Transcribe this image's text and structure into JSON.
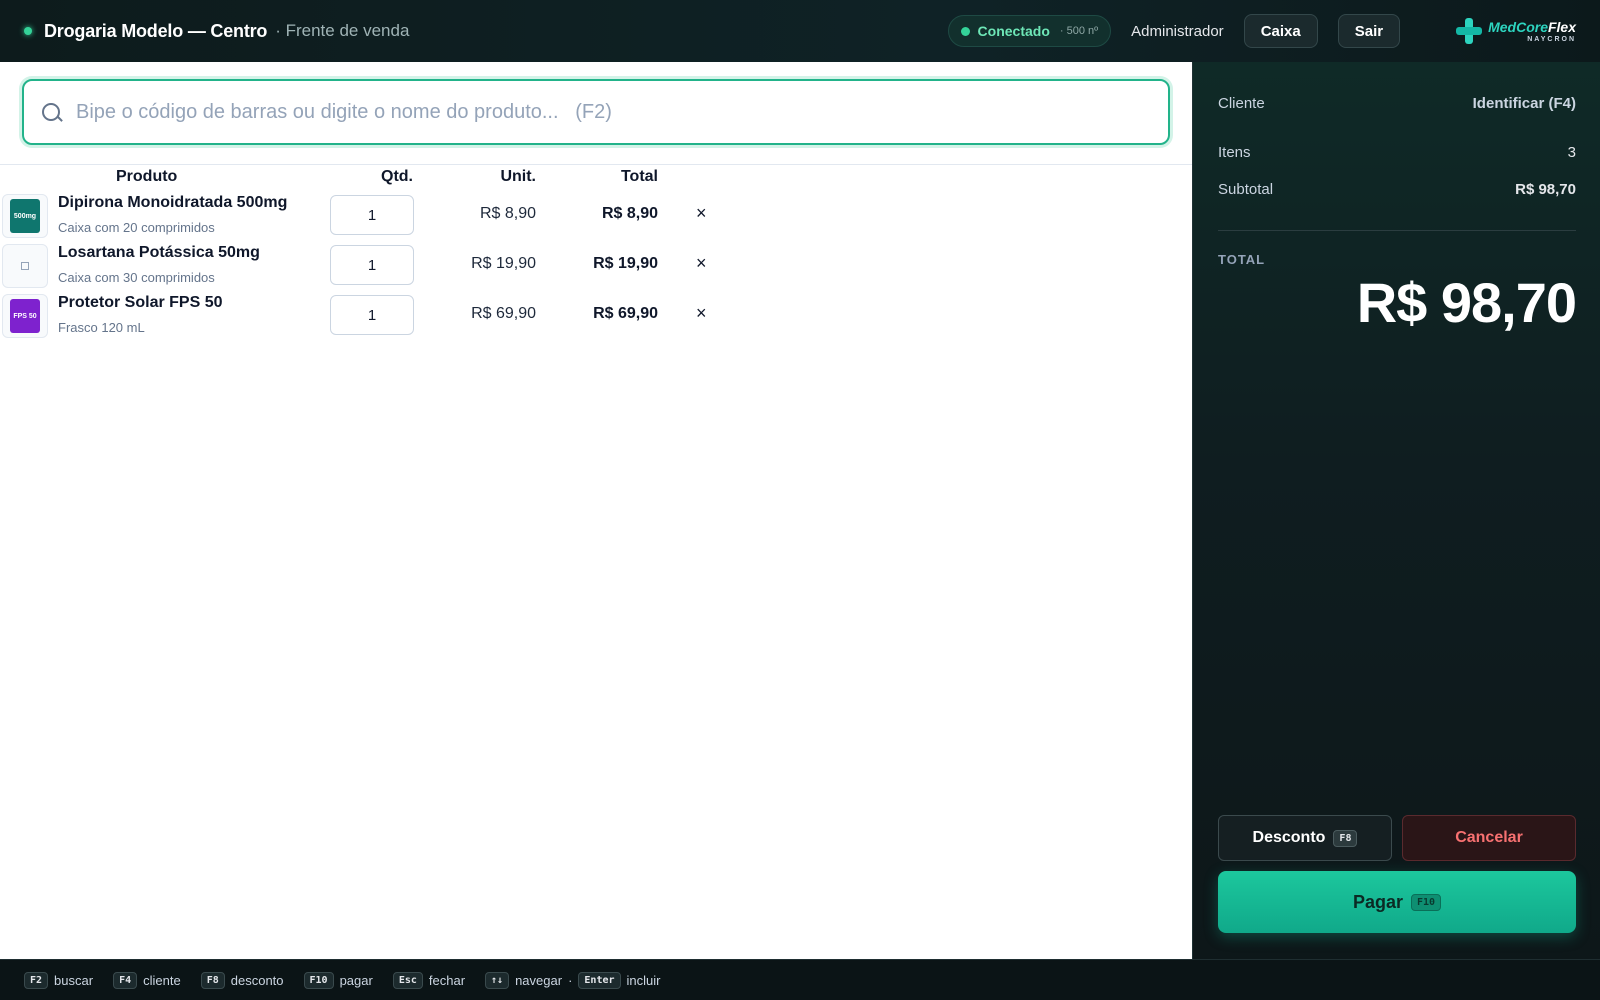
{
  "header": {
    "store_name": "Drogaria Modelo — Centro",
    "screen_name": "· Frente de venda",
    "connection_label": "Conectado",
    "connection_meta": "· 500 nº",
    "user_name": "Administrador",
    "cash_button": "Caixa",
    "logout_button": "Sair",
    "logo_word_a": "MedCore",
    "logo_word_b": "Flex",
    "logo_sub": "NAYCRON"
  },
  "search": {
    "placeholder": "Bipe o código de barras ou digite o nome do produto...   (F2)",
    "value": ""
  },
  "table": {
    "headers": {
      "product": "Produto",
      "qty": "Qtd.",
      "unit": "Unit.",
      "total": "Total"
    },
    "rows": [
      {
        "name": "Dipirona Monoidratada 500mg",
        "desc": "Caixa com 20 comprimidos",
        "qty": "1",
        "unit": "R$ 8,90",
        "total": "R$ 8,90",
        "thumb_label": "500mg",
        "thumb_color": "#0f766e"
      },
      {
        "name": "Losartana Potássica 50mg",
        "desc": "Caixa com 30 comprimidos",
        "qty": "1",
        "unit": "R$ 19,90",
        "total": "R$ 19,90",
        "thumb_label": "",
        "thumb_color": ""
      },
      {
        "name": "Protetor Solar FPS 50",
        "desc": "Frasco 120 mL",
        "qty": "1",
        "unit": "R$ 69,90",
        "total": "R$ 69,90",
        "thumb_label": "FPS 50",
        "thumb_color": "#7e22ce"
      }
    ],
    "remove_symbol": "×"
  },
  "summary": {
    "client_label": "Cliente",
    "client_action": "Identificar (F4)",
    "items_label": "Itens",
    "items_value": "3",
    "subtotal_label": "Subtotal",
    "subtotal_value": "R$ 98,70",
    "total_label": "TOTAL",
    "total_value": "R$ 98,70",
    "discount_button": "Desconto",
    "discount_key": "F8",
    "cancel_button": "Cancelar",
    "pay_button": "Pagar",
    "pay_key": "F10"
  },
  "footer": {
    "shortcuts": [
      {
        "key": "F2",
        "label": "buscar"
      },
      {
        "key": "F4",
        "label": "cliente"
      },
      {
        "key": "F8",
        "label": "desconto"
      },
      {
        "key": "F10",
        "label": "pagar"
      },
      {
        "key": "Esc",
        "label": "fechar"
      },
      {
        "key": "↑↓",
        "label": "navegar"
      },
      {
        "key": "Enter",
        "label": "incluir"
      }
    ]
  },
  "colors": {
    "accent": "#22b38a",
    "pay_button": "#1cc79d",
    "cancel_text": "#f87171",
    "connected": "#34d399"
  }
}
